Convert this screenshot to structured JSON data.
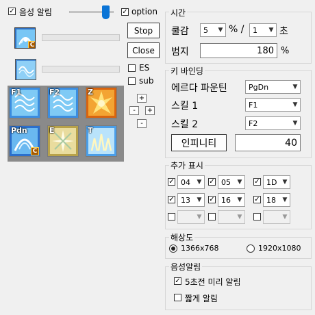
{
  "voice_alert_checkbox": {
    "label": "음성 알림",
    "checked": true
  },
  "volume_slider": {
    "level": 0.78
  },
  "option_checkbox": {
    "label": "option",
    "checked": true
  },
  "buttons": {
    "stop": "Stop",
    "close": "Close"
  },
  "es_checkbox": {
    "label": "ES",
    "checked": false
  },
  "sub_checkbox": {
    "label": "sub",
    "checked": false
  },
  "adjust_buttons": {
    "plus": "+",
    "minus": "-"
  },
  "skill_icons": [
    {
      "hotkey": "F1"
    },
    {
      "hotkey": "F2"
    },
    {
      "hotkey": "Z"
    },
    {
      "hotkey": "Pdn",
      "badge": "C"
    },
    {
      "hotkey": "E"
    },
    {
      "hotkey": "T"
    }
  ],
  "top_icon_badge": "C",
  "time_group": {
    "title": "시간",
    "cooldown_label": "쿨감",
    "cooldown_value": "5",
    "percent_slash": "% /",
    "seconds_value": "1",
    "seconds_unit": "초",
    "width_label": "범지",
    "width_value": "180",
    "width_unit": "%"
  },
  "keybinding_group": {
    "title": "키 바인딩",
    "rows": [
      {
        "label": "에르다 파운틴",
        "value": "PgDn"
      },
      {
        "label": "스킬 1",
        "value": "F1"
      },
      {
        "label": "스킬 2",
        "value": "F2"
      }
    ],
    "infinity_button": "인피니티",
    "infinity_value": "40"
  },
  "extra_group": {
    "title": "추가 표시",
    "rows": [
      [
        {
          "checked": true,
          "value": "04"
        },
        {
          "checked": true,
          "value": "05"
        },
        {
          "checked": true,
          "value": "1D"
        }
      ],
      [
        {
          "checked": true,
          "value": "13"
        },
        {
          "checked": true,
          "value": "16"
        },
        {
          "checked": true,
          "value": "18"
        }
      ],
      [
        {
          "checked": false,
          "value": ""
        },
        {
          "checked": false,
          "value": ""
        },
        {
          "checked": false,
          "value": ""
        }
      ]
    ]
  },
  "resolution_group": {
    "title": "해상도",
    "options": [
      {
        "label": "1366x768",
        "selected": true
      },
      {
        "label": "1920x1080",
        "selected": false
      }
    ]
  },
  "voice_group": {
    "title": "음성알림",
    "options": [
      {
        "label": "5초전 미리 알림",
        "checked": true
      },
      {
        "label": "짧게 알림",
        "checked": false
      }
    ]
  }
}
